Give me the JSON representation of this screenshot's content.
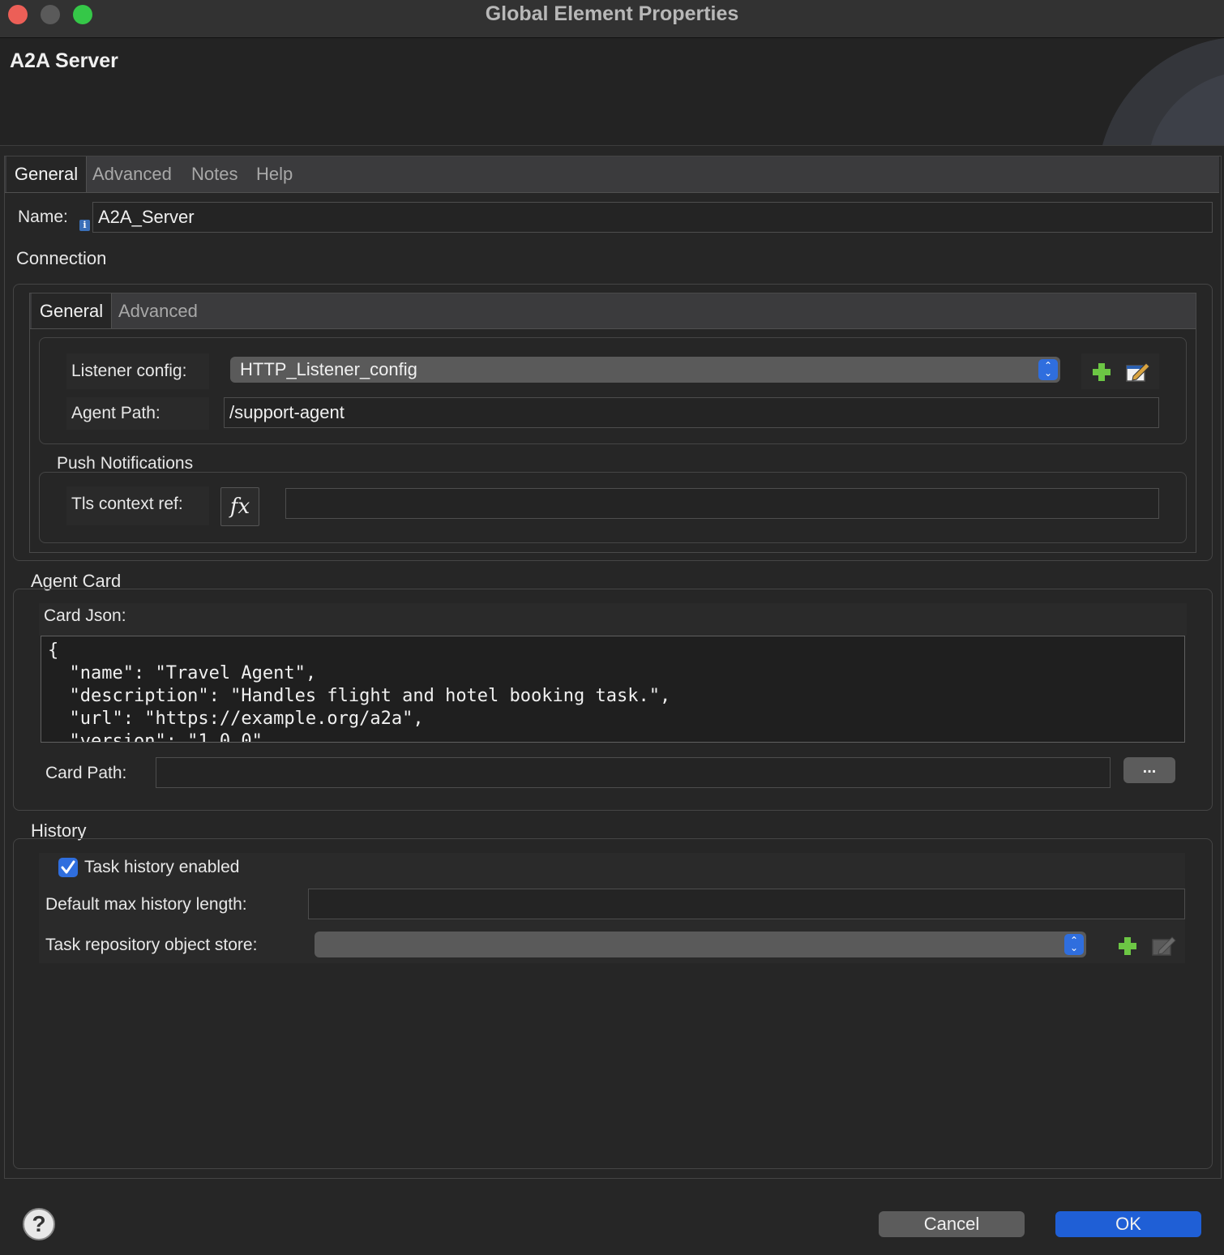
{
  "window": {
    "title": "Global Element Properties",
    "traffic_colors": [
      "#ec5f57",
      "#5a5a5a",
      "#35c748"
    ]
  },
  "banner": {
    "title": "A2A Server"
  },
  "tabs": [
    {
      "label": "General",
      "active": true
    },
    {
      "label": "Advanced",
      "active": false
    },
    {
      "label": "Notes",
      "active": false
    },
    {
      "label": "Help",
      "active": false
    }
  ],
  "name": {
    "label": "Name:",
    "value": "A2A_Server"
  },
  "connection": {
    "title": "Connection",
    "tabs": [
      {
        "label": "General",
        "active": true
      },
      {
        "label": "Advanced",
        "active": false
      }
    ],
    "listener_config": {
      "label": "Listener config:",
      "value": "HTTP_Listener_config"
    },
    "agent_path": {
      "label": "Agent Path:",
      "value": "/support-agent"
    },
    "push_notifications": {
      "title": "Push Notifications",
      "tls_context_ref": {
        "label": "Tls context ref:",
        "value": "",
        "fx_label": "fx"
      }
    }
  },
  "agent_card": {
    "title": "Agent Card",
    "card_json": {
      "label": "Card Json:",
      "value": "{\n  \"name\": \"Travel Agent\",\n  \"description\": \"Handles flight and hotel booking task.\",\n  \"url\": \"https://example.org/a2a\",\n  \"version\": \"1.0.0\""
    },
    "card_path": {
      "label": "Card Path:",
      "value": "",
      "browse_label": "..."
    }
  },
  "history": {
    "title": "History",
    "task_history_enabled": {
      "label": "Task history enabled",
      "checked": true
    },
    "default_max_history_length": {
      "label": "Default max history length:",
      "value": ""
    },
    "task_repository_object_store": {
      "label": "Task repository object store:",
      "value": ""
    }
  },
  "footer": {
    "help_symbol": "?",
    "cancel_label": "Cancel",
    "ok_label": "OK"
  },
  "colors": {
    "accent": "#2f6ede",
    "ok_button": "#1f5fd6",
    "add_icon": "#6cc644"
  },
  "icons": [
    "add-icon",
    "edit-icon",
    "info-icon",
    "function-icon",
    "help-icon",
    "checkbox-check-icon",
    "select-arrows-icon"
  ]
}
